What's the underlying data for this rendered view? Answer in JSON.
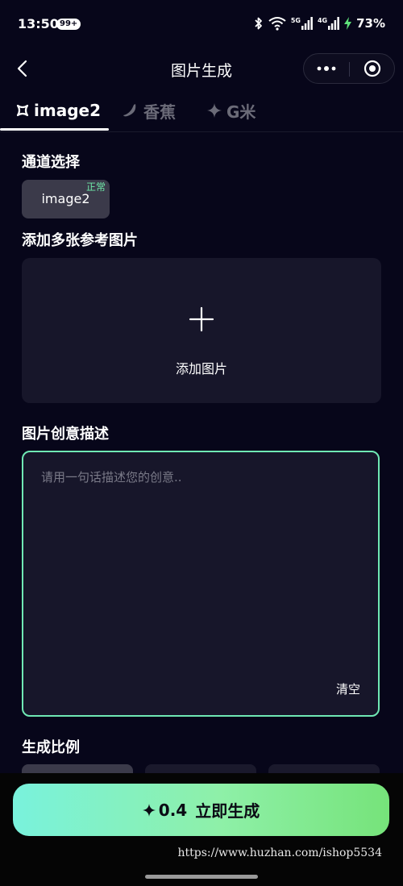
{
  "status_bar": {
    "time": "13:50",
    "notification_badge": "99+",
    "network_5g": "5G",
    "network_4g": "4G",
    "battery": "73%"
  },
  "nav": {
    "title": "图片生成"
  },
  "tabs": [
    {
      "label": "image2",
      "active": true
    },
    {
      "label": "香蕉",
      "active": false
    },
    {
      "label": "G米",
      "active": false
    }
  ],
  "channel": {
    "section_title": "通道选择",
    "option_label": "image2",
    "option_status": "正常"
  },
  "reference": {
    "section_title": "添加多张参考图片",
    "add_label": "添加图片"
  },
  "description": {
    "section_title": "图片创意描述",
    "placeholder": "请用一句话描述您的创意..",
    "value": "",
    "clear_label": "清空"
  },
  "ratio": {
    "section_title": "生成比例"
  },
  "generate": {
    "cost": "0.4",
    "label": "立即生成"
  },
  "watermark": "https://www.huzhan.com/ishop5534",
  "colors": {
    "background": "#07061a",
    "panel": "#17162a",
    "accent_green": "#6fe8b4",
    "status_ok": "#6fe8a8",
    "inactive_tab": "#6b6b78"
  }
}
